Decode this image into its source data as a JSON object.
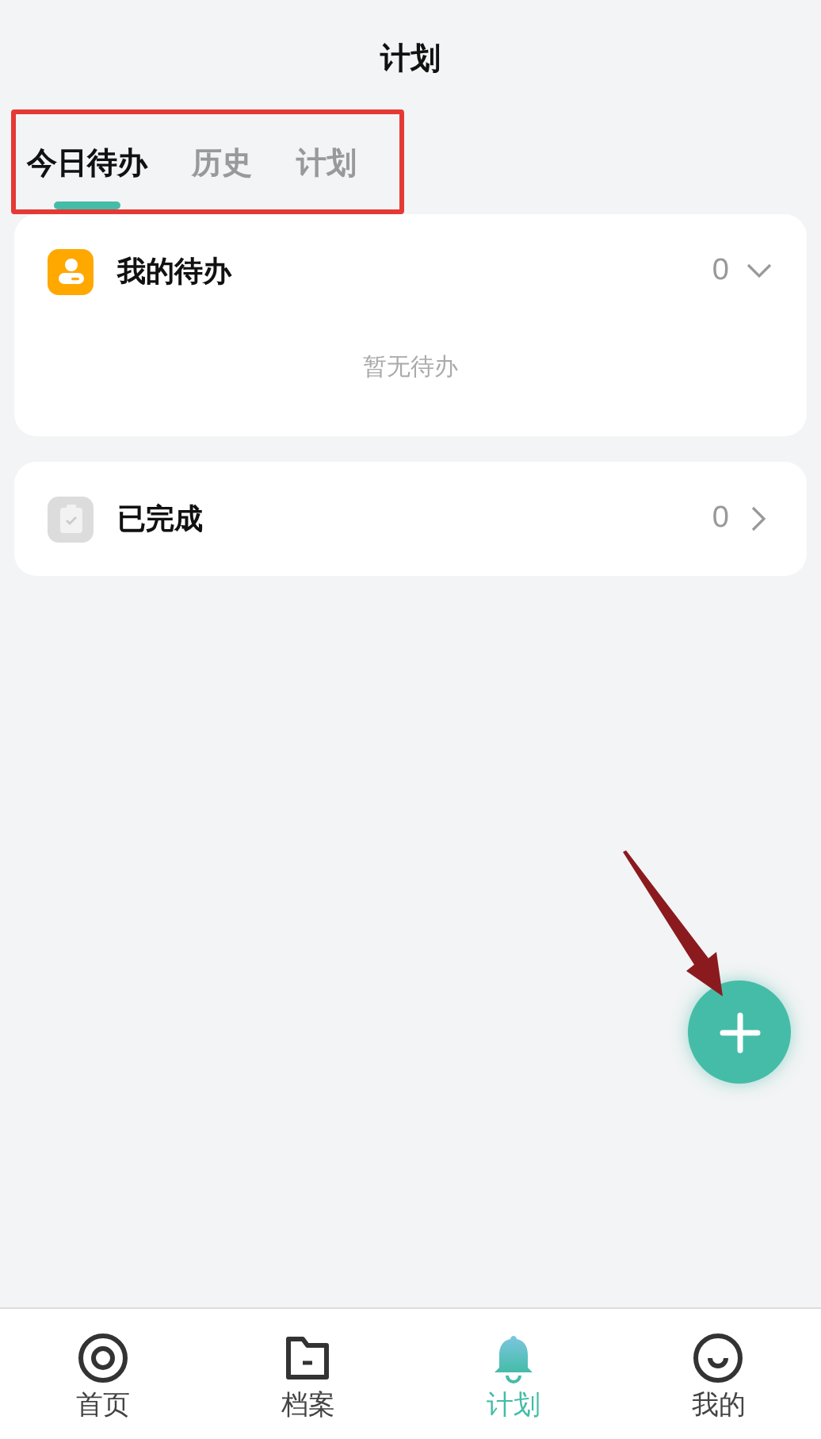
{
  "title": "计划",
  "tabs": [
    {
      "label": "今日待办",
      "selected": true
    },
    {
      "label": "历史",
      "selected": false
    },
    {
      "label": "计划",
      "selected": false
    }
  ],
  "sections": [
    {
      "kind": "todo",
      "label": "我的待办",
      "count": "0",
      "expanded": true,
      "empty_text": "暂无待办"
    },
    {
      "kind": "done",
      "label": "已完成",
      "count": "0",
      "expanded": false
    }
  ],
  "nav": [
    {
      "kind": "home",
      "label": "首页",
      "selected": false
    },
    {
      "kind": "files",
      "label": "档案",
      "selected": false
    },
    {
      "kind": "plan",
      "label": "计划",
      "selected": true
    },
    {
      "kind": "me",
      "label": "我的",
      "selected": false
    }
  ],
  "annotations": {
    "tabs_framed": true,
    "add_button_arrow": true
  }
}
